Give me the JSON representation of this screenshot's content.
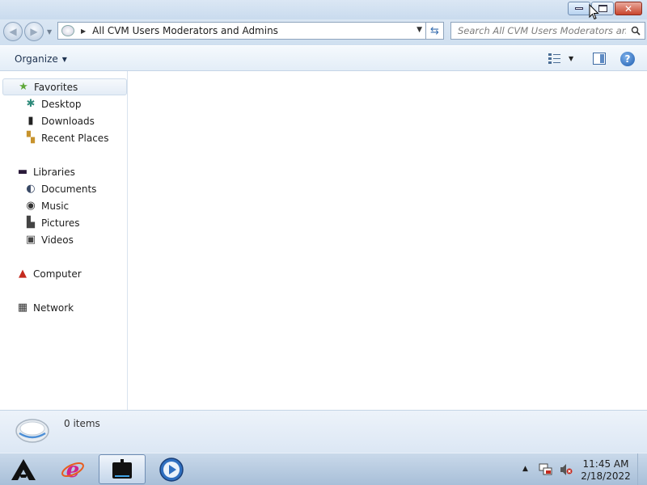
{
  "window": {
    "icons": {
      "minimize": "minimize-icon",
      "maximize": "restore-icon",
      "close": "close-icon"
    }
  },
  "address": {
    "path": "All CVM Users Moderators and Admins",
    "search_placeholder": "Search All CVM Users Moderators and..."
  },
  "toolbar": {
    "organize_label": "Organize",
    "icons": {
      "views": "change-view-icon",
      "preview": "preview-pane-icon",
      "help": "help-icon"
    }
  },
  "sidebar": {
    "favorites": {
      "label": "Favorites",
      "items": [
        {
          "label": "Desktop",
          "icon": "desktop-icon"
        },
        {
          "label": "Downloads",
          "icon": "downloads-icon"
        },
        {
          "label": "Recent Places",
          "icon": "recent-places-icon"
        }
      ]
    },
    "libraries": {
      "label": "Libraries",
      "items": [
        {
          "label": "Documents",
          "icon": "documents-icon"
        },
        {
          "label": "Music",
          "icon": "music-icon"
        },
        {
          "label": "Pictures",
          "icon": "pictures-icon"
        },
        {
          "label": "Videos",
          "icon": "videos-icon"
        }
      ]
    },
    "computer": {
      "label": "Computer"
    },
    "network": {
      "label": "Network"
    }
  },
  "details": {
    "items_count": "0 items"
  },
  "taskbar": {
    "apps": [
      "start-button",
      "internet-explorer-icon",
      "explorer-taskbar-icon",
      "media-player-icon"
    ],
    "clock_time": "11:45 AM",
    "clock_date": "2/18/2022"
  },
  "colors": {
    "accent": "#3d6aa3",
    "close_button": "#c8452d",
    "nav_selected_bg": "#e4ecf6"
  }
}
